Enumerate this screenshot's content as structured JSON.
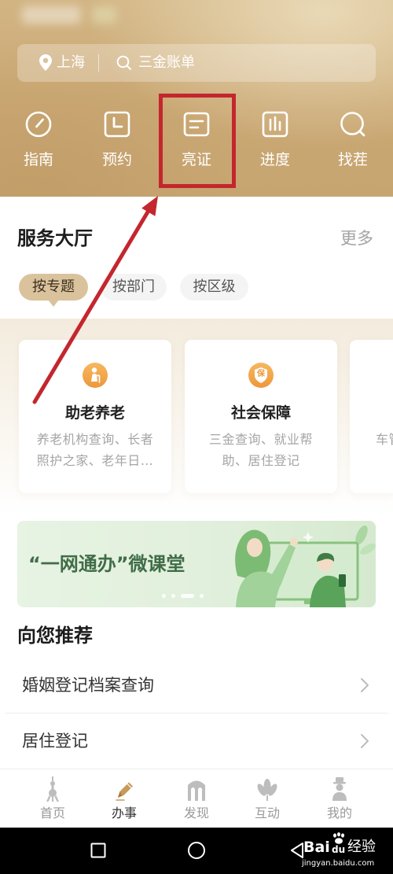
{
  "header": {
    "location": "上海",
    "search_placeholder": "三金账单",
    "quick_actions": [
      {
        "label": "指南",
        "icon": "gauge-icon"
      },
      {
        "label": "预约",
        "icon": "appointment-clock-icon"
      },
      {
        "label": "亮证",
        "icon": "id-card-icon"
      },
      {
        "label": "进度",
        "icon": "bar-chart-icon"
      },
      {
        "label": "找茬",
        "icon": "search-circle-icon"
      }
    ]
  },
  "annotation": {
    "color": "#c4262e"
  },
  "service_hall": {
    "title": "服务大厅",
    "more": "更多",
    "tabs": [
      {
        "label": "按专题",
        "selected": true
      },
      {
        "label": "按部门",
        "selected": false
      },
      {
        "label": "按区级",
        "selected": false
      }
    ],
    "cards": [
      {
        "title": "助老养老",
        "icon": "elderly-care-icon",
        "desc_lines": [
          "养老机构查询、长者",
          "照护之家、老年日…"
        ]
      },
      {
        "title": "社会保障",
        "icon": "shield-icon",
        "icon_text": "保",
        "desc_lines": [
          "三金查询、就业帮",
          "助、居住登记"
        ]
      },
      {
        "desc_lines": [
          "车管"
        ]
      }
    ]
  },
  "banner": {
    "title": "“一网通办”微课堂"
  },
  "recommend": {
    "title": "向您推荐",
    "items": [
      "婚姻登记档案查询",
      "居住登记"
    ]
  },
  "bottom_nav": [
    {
      "label": "首页",
      "icon": "tower-icon",
      "active": false
    },
    {
      "label": "办事",
      "icon": "pen-icon",
      "active": true
    },
    {
      "label": "发现",
      "icon": "arch-building-icon",
      "active": false
    },
    {
      "label": "互动",
      "icon": "flower-icon",
      "active": false
    },
    {
      "label": "我的",
      "icon": "person-hat-icon",
      "active": false
    }
  ],
  "watermark": {
    "brand_a": "Bai",
    "brand_b": "du",
    "brand_c": "经验",
    "url": "jingyan.baidu.com"
  },
  "colors": {
    "header_gold": "#c9a774",
    "active_tab": "#dac39c",
    "card_icon_orange": "#f0a040",
    "banner_green": "#e0efdb",
    "banner_text": "#3f6d48",
    "active_nav_icon": "#c89a5c"
  }
}
